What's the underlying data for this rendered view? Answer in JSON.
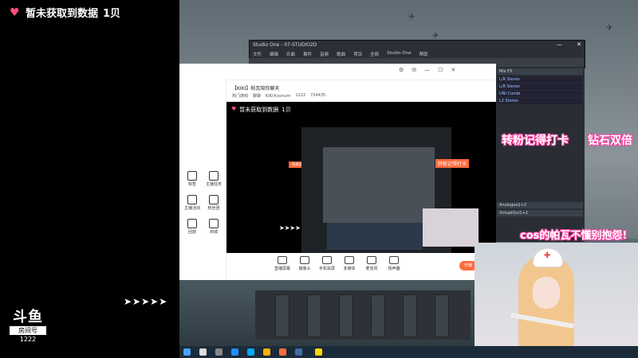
{
  "overlay": {
    "top_title": "暂未获取到数据",
    "top_suffix": "1贝",
    "logo_text": "斗鱼",
    "room_label": "房间号",
    "room_number": "1222"
  },
  "studio_one": {
    "title": "Studio One - 07-STUDIO2D",
    "menu": [
      "文件",
      "编辑",
      "乐曲",
      "事件",
      "音频",
      "歌曲",
      "项目",
      "全局",
      "Studio One",
      "帮助"
    ],
    "mix_fx_label": "Mix FX",
    "mix_ch_label": "Mix FX",
    "mix_rows": [
      "L/R Stereo",
      "L/R Stereo",
      "UNI Combi",
      "L2 Stereo"
    ],
    "analog_label": "Analogue1+2",
    "virtual_label": "VirtualOut1+2"
  },
  "douyu_studio": {
    "logo": "斗鱼",
    "room_title": "【KIKI】帕瓦陪你聊天",
    "room_sub": [
      "热门游戏",
      "聊聊",
      "KIKI大sonum",
      "1222",
      "724435"
    ],
    "preview_title": "暂未获取到数据",
    "preview_suffix": "1贝",
    "preview_tag": "快来领福利开礼物一",
    "sidebar": [
      "直播",
      "推荐",
      "标签",
      "主播任务",
      "主播活动",
      "粉丝团",
      "精华帖",
      "回放",
      "商城",
      "更多"
    ],
    "controls": [
      "直播屏幕",
      "摄像头",
      "手机投屏",
      "多媒体",
      "麦克风",
      "扬声器"
    ],
    "start_label": "开播"
  },
  "overlays": {
    "deco1": "转粉记得打卡",
    "deco2": "钻石双倍",
    "deco3": "cos的帕瓦不懂别抱怨!"
  },
  "colors": {
    "accent": "#ff6a3d",
    "pink": "#ff3fa0"
  }
}
